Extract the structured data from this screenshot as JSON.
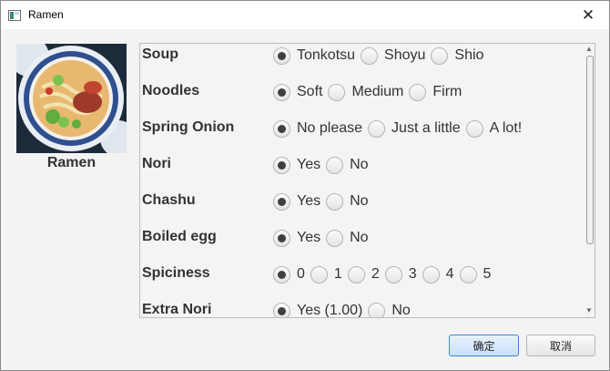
{
  "window": {
    "title": "Ramen",
    "close_glyph": "✕"
  },
  "sidebar": {
    "image_caption": "Ramen"
  },
  "options": [
    {
      "label": "Soup",
      "choices": [
        "Tonkotsu",
        "Shoyu",
        "Shio"
      ],
      "selected": 0
    },
    {
      "label": "Noodles",
      "choices": [
        "Soft",
        "Medium",
        "Firm"
      ],
      "selected": 0
    },
    {
      "label": "Spring Onion",
      "choices": [
        "No please",
        "Just a little",
        "A lot!"
      ],
      "selected": 0
    },
    {
      "label": "Nori",
      "choices": [
        "Yes",
        "No"
      ],
      "selected": 0
    },
    {
      "label": "Chashu",
      "choices": [
        "Yes",
        "No"
      ],
      "selected": 0
    },
    {
      "label": "Boiled egg",
      "choices": [
        "Yes",
        "No"
      ],
      "selected": 0
    },
    {
      "label": "Spiciness",
      "choices": [
        "0",
        "1",
        "2",
        "3",
        "4",
        "5"
      ],
      "selected": 0
    },
    {
      "label": "Extra Nori",
      "choices": [
        "Yes (1.00)",
        "No"
      ],
      "selected": 0
    }
  ],
  "buttons": {
    "ok": "确定",
    "cancel": "取消"
  },
  "colors": {
    "accent": "#3b85d8",
    "radio_dot": "#3f3f3f"
  }
}
